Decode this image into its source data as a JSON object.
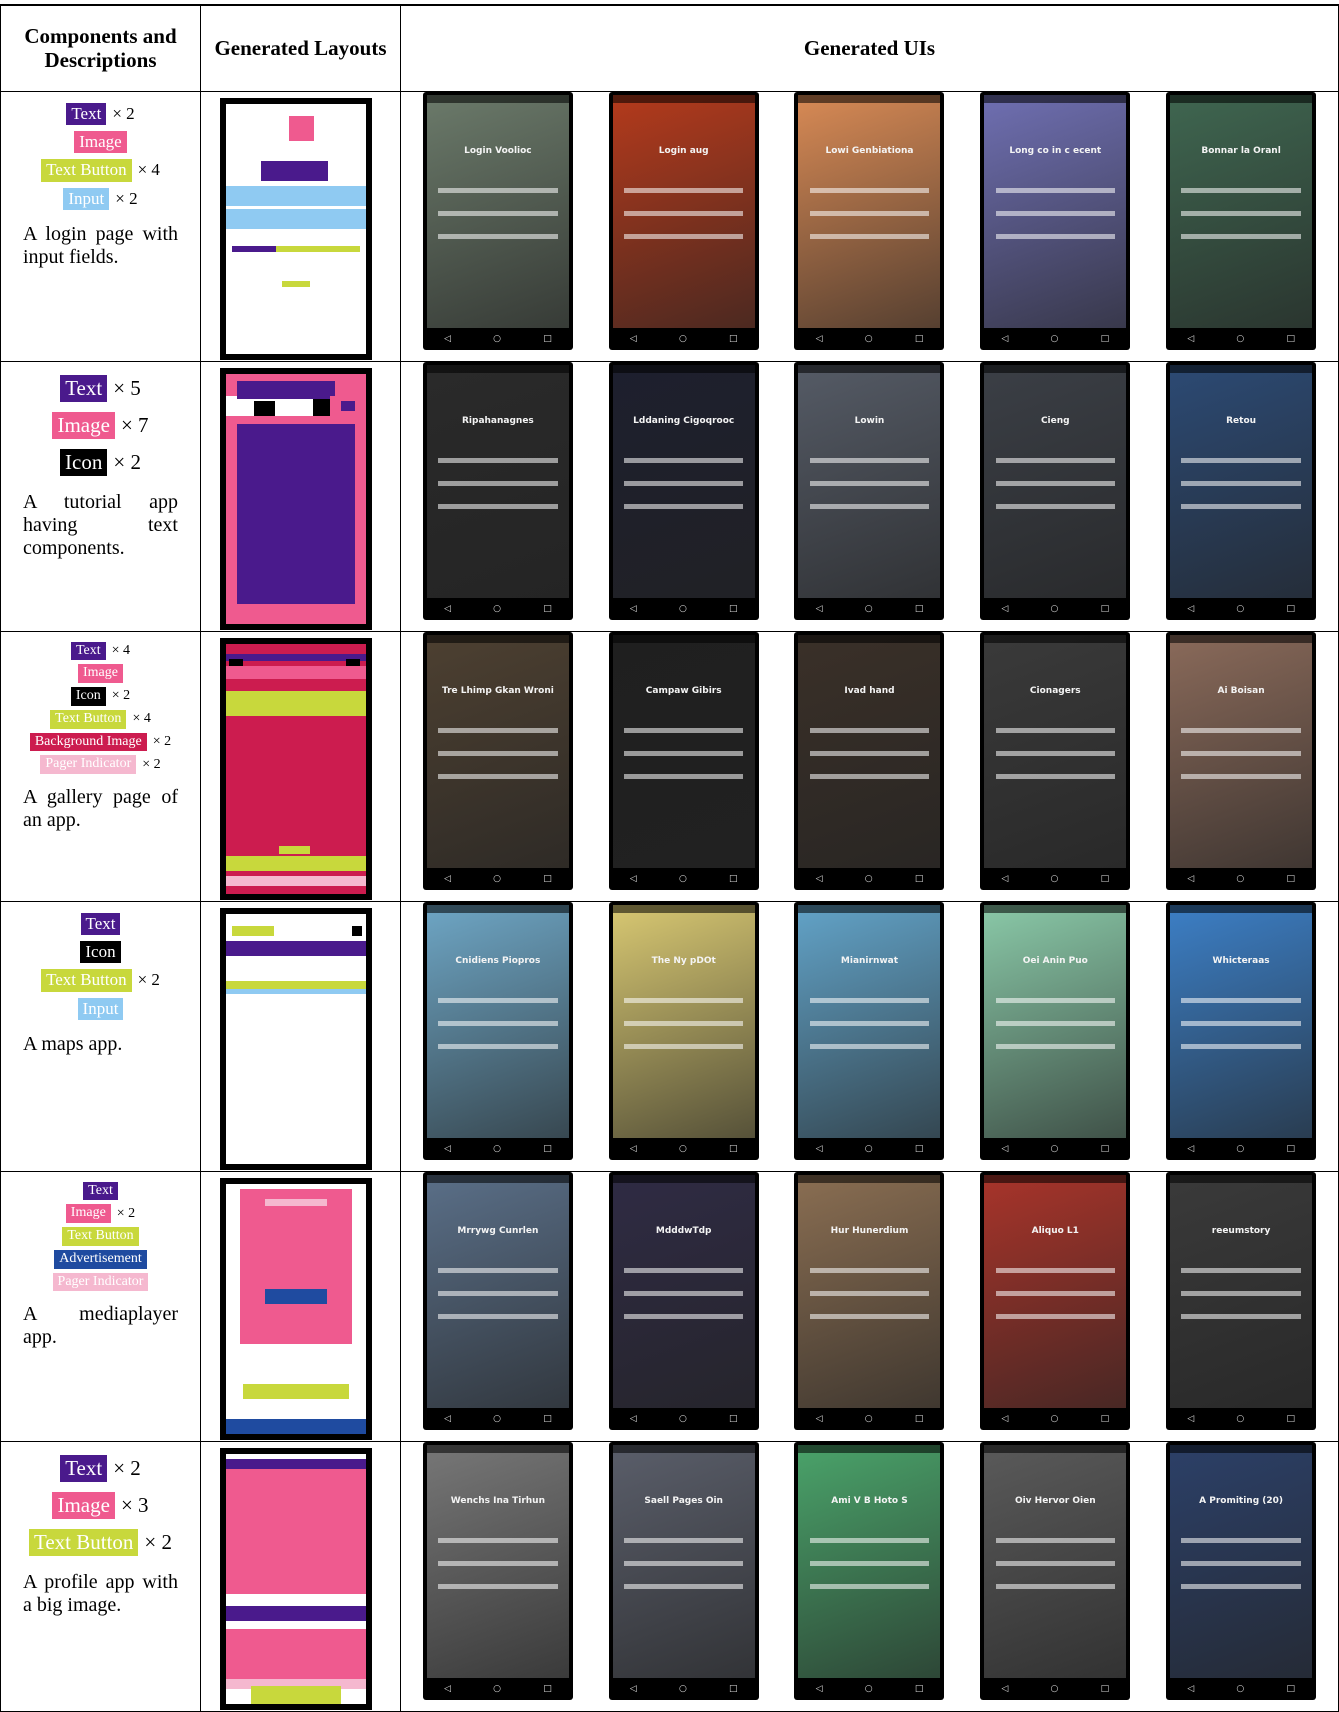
{
  "headers": {
    "col1": "Components and Descriptions",
    "col2": "Generated Layouts",
    "col3": "Generated UIs"
  },
  "colors": {
    "text": "#4a1a8c",
    "image": "#ef5a8f",
    "text_button": "#c8d83c",
    "input": "#8fcaf2",
    "icon": "#000000",
    "background_image": "#cc1c4f",
    "pager_indicator": "#f5b8cf",
    "advertisement": "#1f4ba0"
  },
  "rows": [
    {
      "components": [
        {
          "label": "Text",
          "kind": "text",
          "mult": "× 2"
        },
        {
          "label": "Image",
          "kind": "image",
          "mult": ""
        },
        {
          "label": "Text Button",
          "kind": "text_button",
          "mult": "× 4"
        },
        {
          "label": "Input",
          "kind": "input",
          "mult": "× 2"
        }
      ],
      "description": "A login page with input fields."
    },
    {
      "components": [
        {
          "label": "Text",
          "kind": "text",
          "mult": "× 5"
        },
        {
          "label": "Image",
          "kind": "image",
          "mult": "× 7"
        },
        {
          "label": "Icon",
          "kind": "icon",
          "mult": "× 2"
        }
      ],
      "description": "A tutorial app having text components."
    },
    {
      "components": [
        {
          "label": "Text",
          "kind": "text",
          "mult": "× 4"
        },
        {
          "label": "Image",
          "kind": "image",
          "mult": ""
        },
        {
          "label": "Icon",
          "kind": "icon",
          "mult": "× 2"
        },
        {
          "label": "Text Button",
          "kind": "text_button",
          "mult": "× 4"
        },
        {
          "label": "Background Image",
          "kind": "background_image",
          "mult": "× 2"
        },
        {
          "label": "Pager Indicator",
          "kind": "pager_indicator",
          "mult": "× 2"
        }
      ],
      "description": "A gallery page of an app."
    },
    {
      "components": [
        {
          "label": "Text",
          "kind": "text",
          "mult": ""
        },
        {
          "label": "Icon",
          "kind": "icon",
          "mult": ""
        },
        {
          "label": "Text Button",
          "kind": "text_button",
          "mult": "× 2"
        },
        {
          "label": "Input",
          "kind": "input",
          "mult": ""
        }
      ],
      "description": "A maps app."
    },
    {
      "components": [
        {
          "label": "Text",
          "kind": "text",
          "mult": ""
        },
        {
          "label": "Image",
          "kind": "image",
          "mult": "× 2"
        },
        {
          "label": "Text Button",
          "kind": "text_button",
          "mult": ""
        },
        {
          "label": "Advertisement",
          "kind": "advertisement",
          "mult": ""
        },
        {
          "label": "Pager Indicator",
          "kind": "pager_indicator",
          "mult": ""
        }
      ],
      "description": "A mediaplayer app."
    },
    {
      "components": [
        {
          "label": "Text",
          "kind": "text",
          "mult": "× 2"
        },
        {
          "label": "Image",
          "kind": "image",
          "mult": "× 3"
        },
        {
          "label": "Text Button",
          "kind": "text_button",
          "mult": "× 2"
        }
      ],
      "description": "A profile app with a big image."
    }
  ],
  "ui_texts": [
    [
      "Login Voolioc",
      "Login aug",
      "Lowi Genbiationa",
      "Long co in c ecent",
      "Bonnar la Oranl"
    ],
    [
      "Ripahanagnes",
      "Lddaning Cigoqrooc",
      "Lowin",
      "Cieng",
      "Retou"
    ],
    [
      "Tre Lhimp Gkan Wroni",
      "Campaw Gibirs",
      "Ivad hand",
      "Cionagers",
      "Ai Boisan"
    ],
    [
      "Cnidiens Piopros",
      "The Ny pDOt",
      "Mianirnwat",
      "Oei Anin Puo",
      "Whicteraas"
    ],
    [
      "Mrrywg Cunrlen",
      "MdddwTdp",
      "Hur Hunerdium",
      "Aliquo L1",
      "reeumstory"
    ],
    [
      "Wenchs Ina Tirhun",
      "Saell Pages Oin",
      "Ami V B Hoto S",
      "Oiv Hervor Oien",
      "A Promiting (20)"
    ]
  ]
}
